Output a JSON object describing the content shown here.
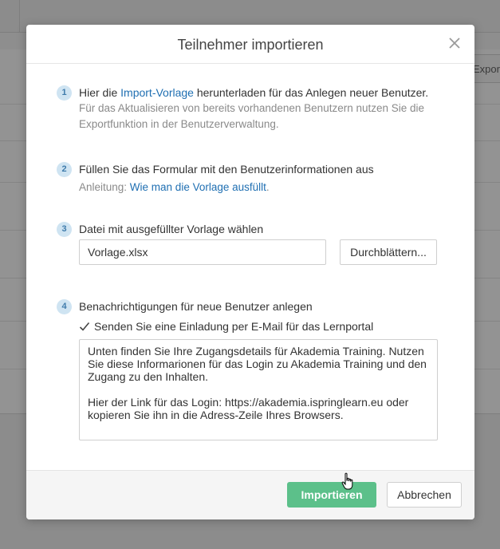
{
  "background": {
    "export_label": "Expor"
  },
  "modal": {
    "title": "Teilnehmer importieren",
    "close_icon": "close-icon"
  },
  "steps": [
    {
      "number": "1",
      "title_prefix": "Hier die ",
      "title_link": "Import-Vorlage",
      "title_suffix": " herunterladen für das Anlegen neuer Benutzer.",
      "subtitle": "Für das Aktualisieren von bereits vorhandenen Benutzern nutzen Sie die Exportfunktion in der Benutzerverwaltung."
    },
    {
      "number": "2",
      "title": "Füllen Sie das Formular mit den Benutzerinformationen aus",
      "subtitle_prefix": "Anleitung: ",
      "subtitle_link": "Wie man die Vorlage ausfüllt",
      "subtitle_suffix": "."
    },
    {
      "number": "3",
      "title": "Datei mit ausgefüllter Vorlage wählen",
      "file_value": "Vorlage.xlsx",
      "browse_label": "Durchblättern..."
    },
    {
      "number": "4",
      "title": "Benachrichtigungen für neue Benutzer anlegen",
      "checkbox_label": "Senden Sie eine Einladung per E-Mail für das Lernportal",
      "checkbox_checked": true,
      "invite_text": "Unten finden Sie Ihre Zugangsdetails für Akademia Training. Nutzen Sie diese Informarionen für das Login zu Akademia Training und den Zugang zu den Inhalten.\n\nHier der Link für das Login: https://akademia.ispringlearn.eu oder kopieren Sie ihn in die Adress-Zeile Ihres Browsers."
    }
  ],
  "footer": {
    "import_label": "Importieren",
    "cancel_label": "Abbrechen"
  },
  "colors": {
    "accent_link": "#1f6fb2",
    "primary_button": "#5cc08a",
    "step_badge_bg": "#cfe4f2"
  }
}
